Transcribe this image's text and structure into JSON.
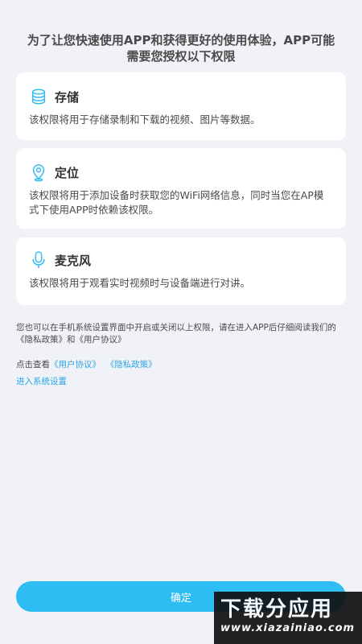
{
  "intro": {
    "line1": "为了让您快速使用APP和获得更好的使用体验，APP可能",
    "line2": "需要您授权以下权限"
  },
  "permissions": [
    {
      "icon": "database-icon",
      "title": "存储",
      "desc": "该权限将用于存储录制和下载的视频、图片等数据。"
    },
    {
      "icon": "location-pin-icon",
      "title": "定位",
      "desc": "该权限将用于添加设备时获取您的WiFi网络信息，同时当您在AP模式下使用APP时依赖该权限。"
    },
    {
      "icon": "microphone-icon",
      "title": "麦克风",
      "desc": "该权限将用于观看实时视频时与设备端进行对讲。"
    }
  ],
  "note": "您也可以在手机系统设置界面中开启或关闭以上权限，请在进入APP后仔细阅读我们的《隐私政策》和《用户协议》",
  "links": {
    "prefix": "点击查看",
    "user_agreement": "《用户协议》",
    "privacy_policy": "《隐私政策》"
  },
  "settings_link": "进入系统设置",
  "confirm_label": "确定",
  "watermark": {
    "main": "下载分应用",
    "sub": "www.xiazainiao.com"
  },
  "colors": {
    "accent": "#2ebdf3",
    "link": "#2aa7e6",
    "background": "#f1f2f7"
  }
}
